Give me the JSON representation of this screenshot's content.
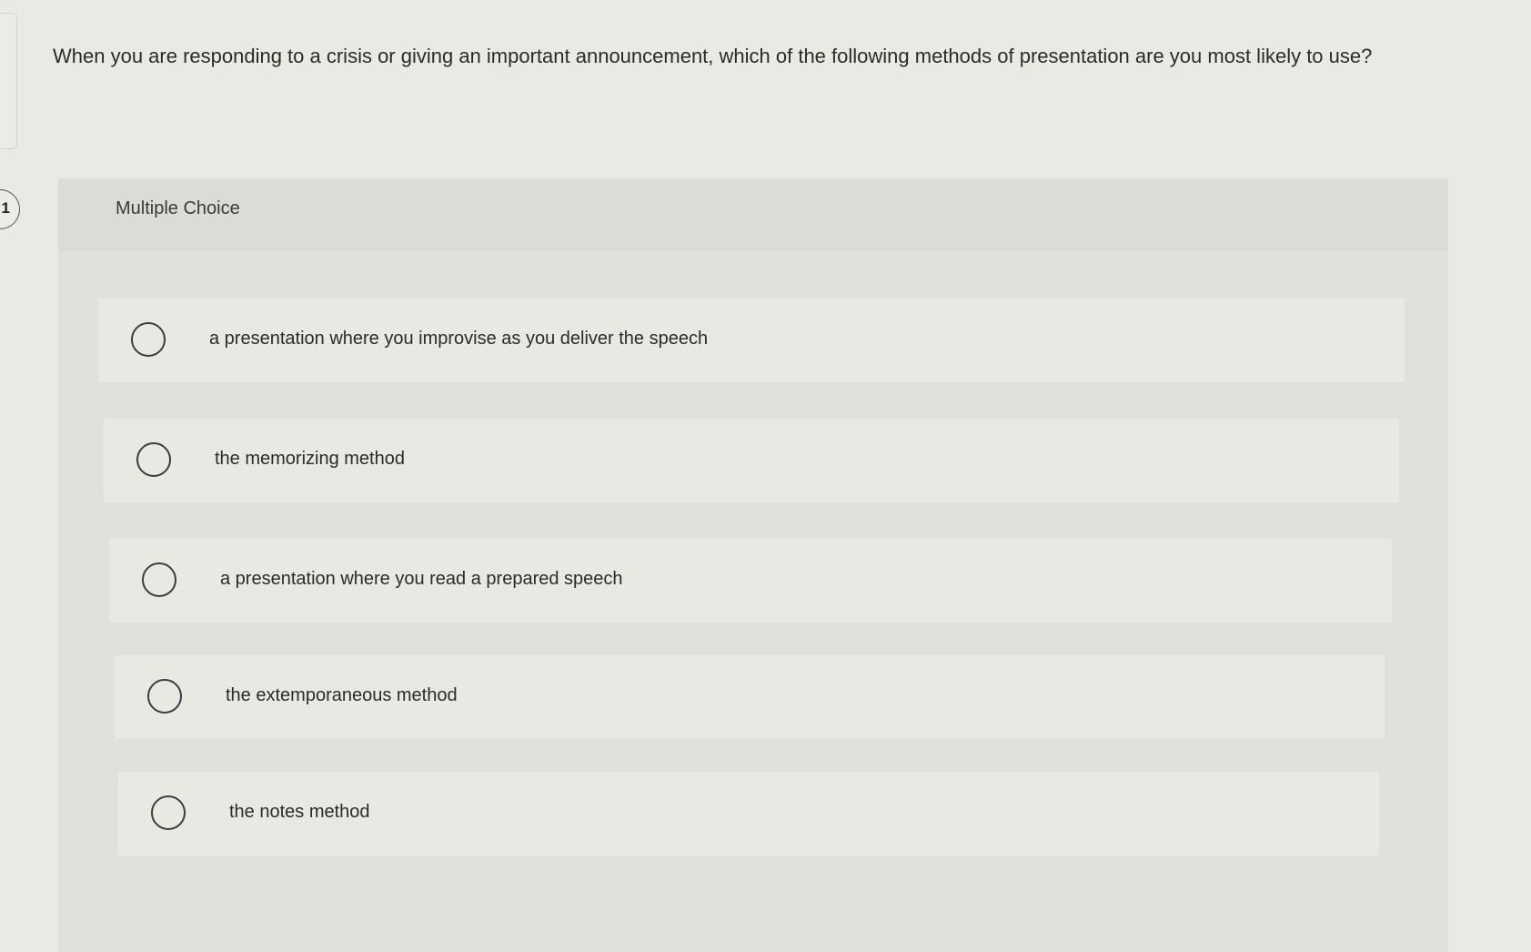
{
  "question": {
    "number": "1",
    "text": "When you are responding to a crisis or giving an important announcement, which of the following methods of presentation are you most likely to use?"
  },
  "panel": {
    "title": "Multiple Choice"
  },
  "options": [
    {
      "label": "a presentation where you improvise as you deliver the speech",
      "selected": false
    },
    {
      "label": "the memorizing method",
      "selected": false
    },
    {
      "label": "a presentation where you read a prepared speech",
      "selected": false
    },
    {
      "label": "the extemporaneous method",
      "selected": false
    },
    {
      "label": "the notes method",
      "selected": false
    }
  ]
}
